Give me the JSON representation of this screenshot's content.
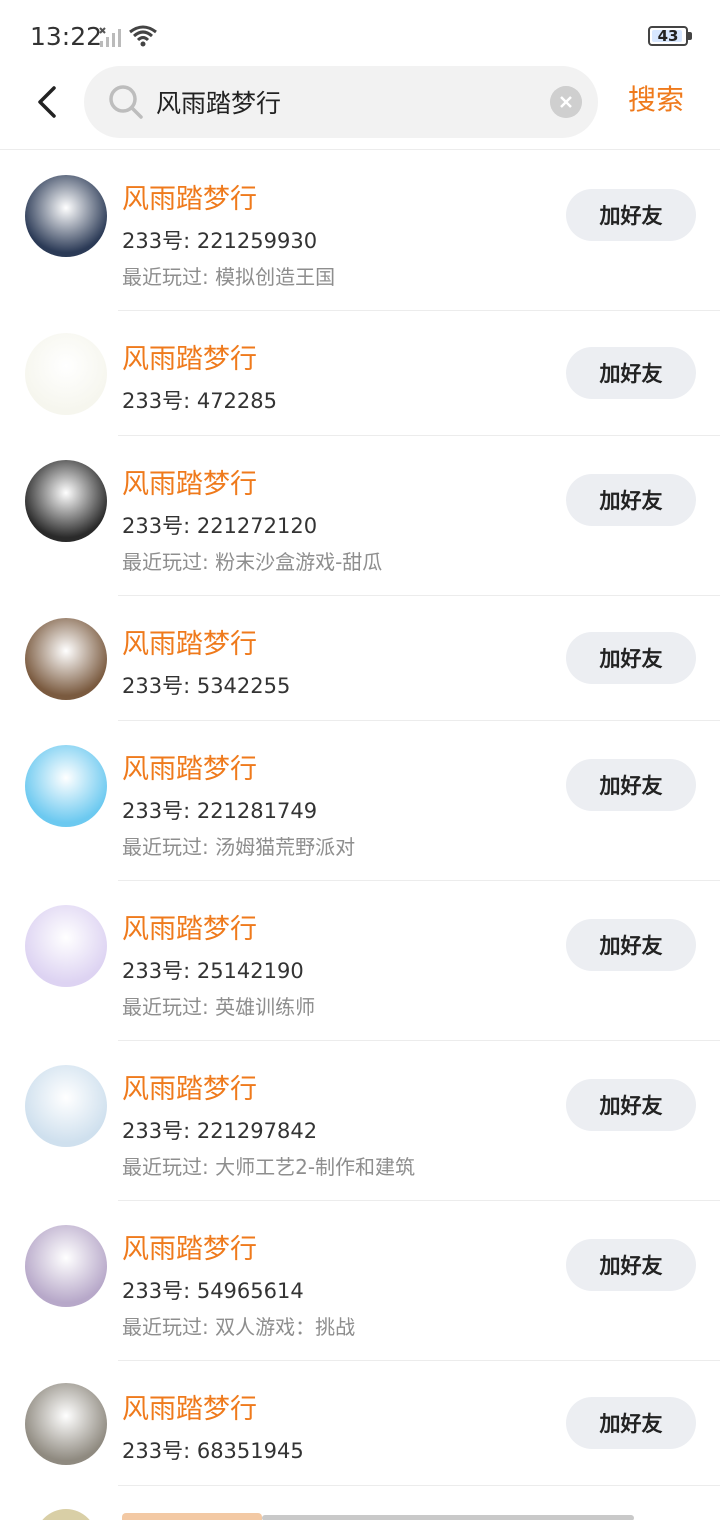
{
  "status_bar": {
    "time": "13:22",
    "battery": "43"
  },
  "search": {
    "query": "风雨踏梦行",
    "submit_label": "搜索"
  },
  "add_label": "加好友",
  "results": [
    {
      "name": "风雨踏梦行",
      "uid": "233号: 221259930",
      "recent": "最近玩过: 模拟创造王国",
      "avatar_color": "#2b3a56"
    },
    {
      "name": "风雨踏梦行",
      "uid": "233号: 472285",
      "recent": "",
      "avatar_color": "#f6f6ee"
    },
    {
      "name": "风雨踏梦行",
      "uid": "233号: 221272120",
      "recent": "最近玩过: 粉末沙盒游戏-甜瓜",
      "avatar_color": "#2a2a2a"
    },
    {
      "name": "风雨踏梦行",
      "uid": "233号: 5342255",
      "recent": "",
      "avatar_color": "#7a5a3f"
    },
    {
      "name": "风雨踏梦行",
      "uid": "233号: 221281749",
      "recent": "最近玩过: 汤姆猫荒野派对",
      "avatar_color": "#6cc9f0"
    },
    {
      "name": "风雨踏梦行",
      "uid": "233号: 25142190",
      "recent": "最近玩过: 英雄训练师",
      "avatar_color": "#ddd3f2"
    },
    {
      "name": "风雨踏梦行",
      "uid": "233号: 221297842",
      "recent": "最近玩过: 大师工艺2-制作和建筑",
      "avatar_color": "#cfe0ee"
    },
    {
      "name": "风雨踏梦行",
      "uid": "233号: 54965614",
      "recent": "最近玩过: 双人游戏：挑战",
      "avatar_color": "#b7a8c9"
    },
    {
      "name": "风雨踏梦行",
      "uid": "233号: 68351945",
      "recent": "",
      "avatar_color": "#8f8a80"
    }
  ],
  "colors": {
    "accent": "#ef7a1c",
    "button_bg": "#eceef2"
  }
}
